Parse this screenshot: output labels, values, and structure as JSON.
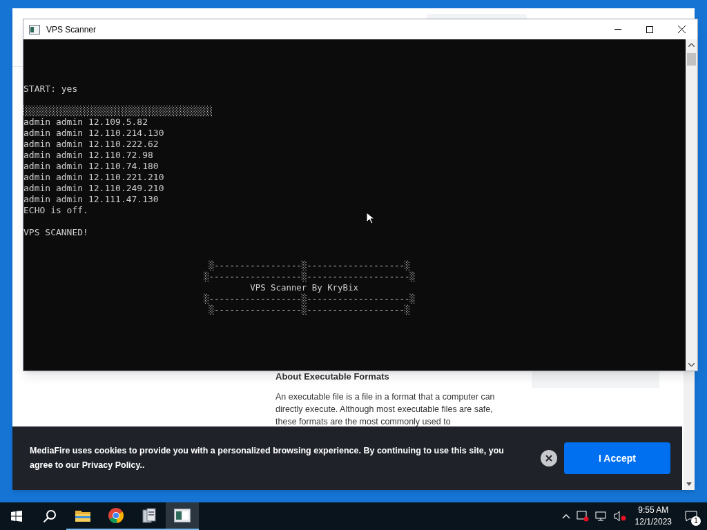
{
  "browser": {
    "heading": "About Executable Formats",
    "paragraph": "An executable file is a file in a format that a computer can directly execute. Although most executable files are safe, these formats are the most commonly used to"
  },
  "console_window": {
    "title": "VPS Scanner",
    "blocks": [
      [
        "START: yes"
      ],
      [
        "░░░░░░░░░░░░░░░░░░░░░░░░░░░░░░░░░░░",
        "admin admin 12.109.5.82",
        "admin admin 12.110.214.130",
        "admin admin 12.110.222.62",
        "admin admin 12.110.72.98",
        "admin admin 12.110.74.180",
        "admin admin 12.110.221.210",
        "admin admin 12.110.249.210",
        "admin admin 12.111.47.130",
        "ECHO is off."
      ],
      [
        "VPS SCANNED!"
      ]
    ],
    "banner": [
      "                                    ░-----------------░-------------------░",
      "                                   ░------------------░--------------------░",
      "                                            VPS Scanner By KryBix",
      "                                   ░------------------░--------------------░",
      "                                    ░-----------------░-------------------░"
    ]
  },
  "cookie_bar": {
    "message": "MediaFire uses cookies to provide you with a personalized browsing experience. By continuing to use this site, you agree to our Privacy Policy..",
    "accept": "I Accept"
  },
  "taskbar": {
    "apps": [
      {
        "kind": "files",
        "selected": false
      },
      {
        "kind": "browser",
        "selected": false
      },
      {
        "kind": "tool",
        "selected": false
      },
      {
        "kind": "console",
        "selected": true
      }
    ],
    "time": "9:55 AM",
    "date": "12/1/2023",
    "notifications": "1"
  }
}
